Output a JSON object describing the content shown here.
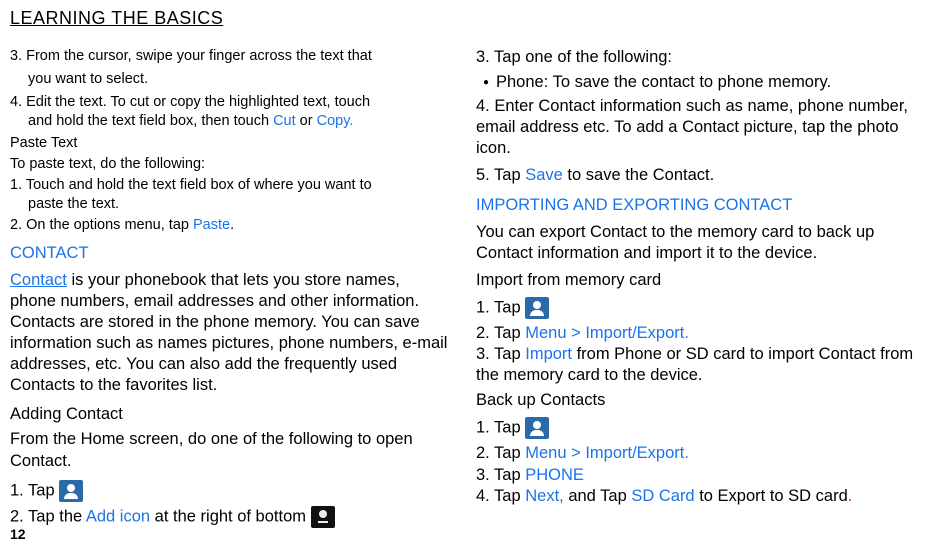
{
  "header": "LEARNING THE BASICS",
  "page_number": "12",
  "left": {
    "step3a": "3. From the cursor, swipe your finger across the text that",
    "step3b": "you want to select.",
    "step4a": "4. Edit the text. To cut or copy the highlighted text, touch",
    "step4b": "and hold the text field box, then touch ",
    "cut": "Cut",
    "or": " or ",
    "copy": "Copy.",
    "paste_heading": "Paste Text",
    "paste_intro": "To paste text, do the following:",
    "paste_step1a": "1. Touch and hold the text field box of where you want to",
    "paste_step1b": "paste the text.",
    "paste_step2a": "2. On the options menu, tap ",
    "paste_label": "Paste",
    "paste_step2b": ".",
    "contact_heading": "CONTACT",
    "contact_link": "Contact",
    "contact_body": " is your phonebook that lets you store names, phone numbers, email addresses and other information. Contacts are stored in the phone memory. You can save information such as names pictures, phone numbers, e-mail addresses, etc. You can also add the frequently used Contacts to the favorites list.",
    "adding_heading": "Adding Contact",
    "adding_intro": "From the Home screen, do one of the following to open Contact.",
    "adding_step1": "1. Tap ",
    "adding_step2a": "2. Tap the ",
    "add_icon_label": "Add icon",
    "adding_step2b": " at the right of bottom "
  },
  "right": {
    "step3": "3. Tap one of the following:",
    "bullet1": "Phone: To save the contact to phone memory.",
    "step4": "4. Enter Contact information such as name, phone number, email address etc. To add a Contact picture, tap the photo icon.",
    "step5a": "5. Tap ",
    "save": "Save",
    "step5b": " to save the Contact.",
    "import_heading": "IMPORTING AND EXPORTING CONTACT",
    "import_body": "You can export Contact to the memory card to back up Contact information and import it to the device.",
    "import_sub": "Import from memory card",
    "imp_step1": "1. Tap ",
    "imp_step2a": "2. Tap ",
    "menu_ie": "Menu > Import/Export.",
    "imp_step3a": "3. Tap ",
    "import_label": "Import",
    "imp_step3b": " from Phone or SD card to import Contact from the memory card to the device.",
    "backup_heading": "Back up Contacts",
    "bkp_step1": "1. Tap ",
    "bkp_step2a": "2. Tap ",
    "bkp_step3a": "3. Tap ",
    "phone_label": "PHONE",
    "bkp_step4a": "4. Tap ",
    "next_label": "Next,",
    "bkp_step4b": " and Tap ",
    "sdcard_label": "SD Card",
    "bkp_step4c": " to Export to SD card",
    "period_red": "."
  }
}
